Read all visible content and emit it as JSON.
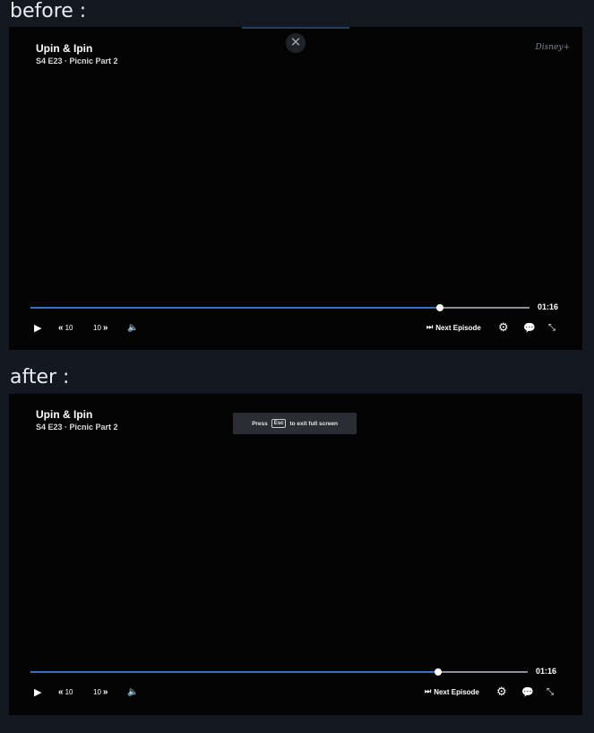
{
  "labels": {
    "before": "before :",
    "after": "after :"
  },
  "player": {
    "title": "Upin & Ipin",
    "subtitle": "S4 E23 · Picnic Part 2",
    "time": "01:16",
    "progress": 0.82,
    "rewind_label": "10",
    "forward_label": "10",
    "next_episode_label": "Next Episode",
    "brand": "Disney+"
  },
  "toast": {
    "press": "Press",
    "key": "Esc",
    "rest": "to exit full screen"
  },
  "icons": {
    "play": "play-icon",
    "rewind": "rewind-10-icon",
    "forward": "forward-10-icon",
    "volume": "volume-icon",
    "next": "skip-next-icon",
    "settings": "gear-icon",
    "subtitles": "subtitles-icon",
    "exit_fullscreen": "exit-fullscreen-icon",
    "close": "close-icon"
  },
  "colors": {
    "accent": "#2f74c9",
    "background": "#141821",
    "player": "#040405"
  }
}
